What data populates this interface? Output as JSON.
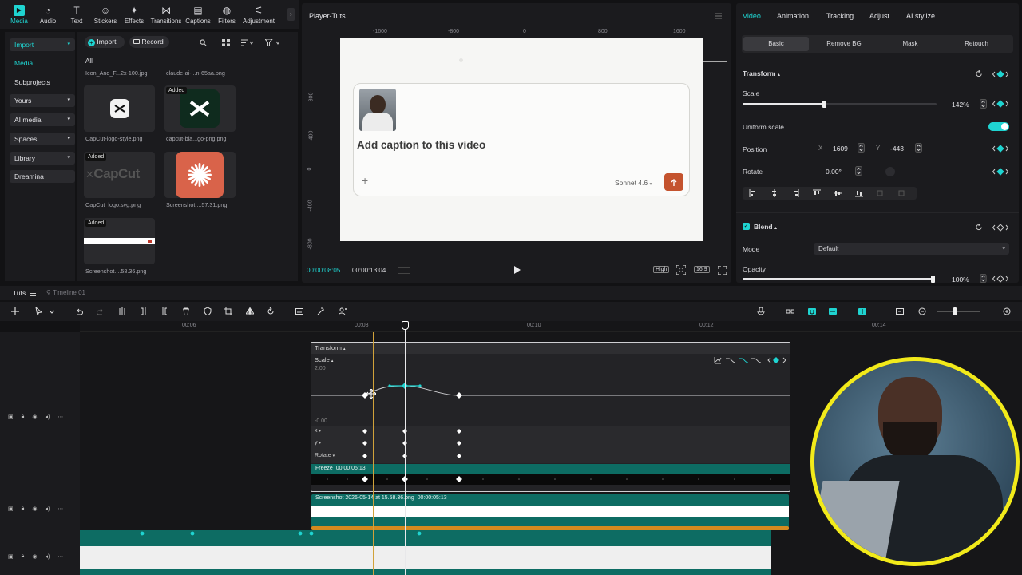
{
  "top_tools": [
    {
      "label": "Media",
      "icon": "media-icon",
      "active": true
    },
    {
      "label": "Audio",
      "icon": "audio-icon"
    },
    {
      "label": "Text",
      "icon": "text-icon"
    },
    {
      "label": "Stickers",
      "icon": "stickers-icon"
    },
    {
      "label": "Effects",
      "icon": "effects-icon"
    },
    {
      "label": "Transitions",
      "icon": "transitions-icon"
    },
    {
      "label": "Captions",
      "icon": "captions-icon"
    },
    {
      "label": "Filters",
      "icon": "filters-icon"
    },
    {
      "label": "Adjustment",
      "icon": "adjustment-icon"
    }
  ],
  "left_nav": {
    "import": "Import",
    "media": "Media",
    "subprojects": "Subprojects",
    "yours": "Yours",
    "ai_media": "AI media",
    "spaces": "Spaces",
    "library": "Library",
    "dreamina": "Dreamina"
  },
  "media": {
    "import_btn": "Import",
    "record_btn": "Record",
    "filter_all": "All",
    "top_captions": [
      "Icon_And_F...2x-100.jpg",
      "claude-ai-...n-65aa.png"
    ],
    "items": [
      {
        "caption": "CapCut-logo-style.png",
        "added": ""
      },
      {
        "caption": "capcut-bla...go-png.png",
        "added": "Added"
      },
      {
        "caption": "CapCut_logo.svg.png",
        "added": "Added"
      },
      {
        "caption": "Screenshot....57.31.png",
        "added": ""
      },
      {
        "caption": "Screenshot....58.36.png",
        "added": "Added"
      }
    ],
    "capcut_text": "CapCut"
  },
  "player": {
    "title": "Player-Tuts",
    "ruler_h": [
      "-1600",
      "-800",
      "0",
      "800",
      "1600"
    ],
    "ruler_v": [
      "800",
      "400",
      "0",
      "-400",
      "-800"
    ],
    "caption": "Add caption to this video",
    "model": "Sonnet 4.6",
    "current_time": "00:00:08:05",
    "total_time": "00:00:13:04",
    "quality": "High",
    "ratio": "16:9"
  },
  "props": {
    "tabs": [
      "Video",
      "Animation",
      "Tracking",
      "Adjust",
      "AI stylize"
    ],
    "subtabs": [
      "Basic",
      "Remove BG",
      "Mask",
      "Retouch"
    ],
    "transform_label": "Transform",
    "scale_label": "Scale",
    "scale_value": "142%",
    "scale_fill": 0.42,
    "uniform_label": "Uniform scale",
    "position_label": "Position",
    "pos_x_label": "X",
    "pos_x": "1609",
    "pos_y_label": "Y",
    "pos_y": "-443",
    "rotate_label": "Rotate",
    "rotate_value": "0.00°",
    "blend_label": "Blend",
    "mode_label": "Mode",
    "mode_value": "Default",
    "opacity_label": "Opacity",
    "opacity_value": "100%",
    "opacity_fill": 1.0,
    "accent": "#1fd4d1"
  },
  "timeline": {
    "project": "Tuts",
    "timeline_name": "Timeline 01",
    "ruler": [
      "00:06",
      "00:08",
      "00:10",
      "00:12",
      "00:14"
    ],
    "transform_label": "Transform",
    "scale_label": "Scale",
    "graph_max": "2.00",
    "graph_min": "-0.00",
    "rows": [
      "x",
      "y",
      "Rotate"
    ],
    "freeze_label": "Freeze",
    "freeze_time": "00:00:05:13",
    "clip_label": "Screenshot 2026-05-14 at 15.58.36.png",
    "clip_time": "00:00:05:13"
  }
}
